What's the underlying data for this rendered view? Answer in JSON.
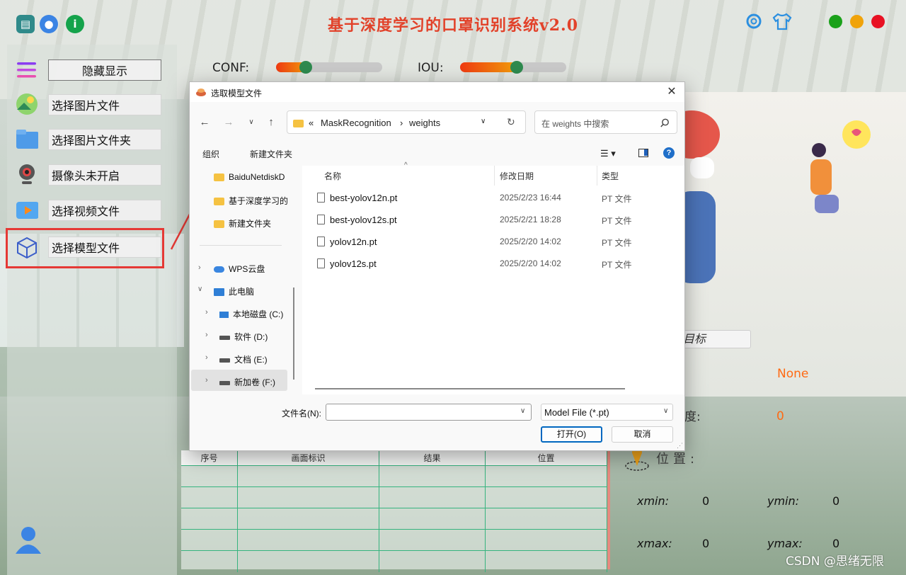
{
  "app": {
    "title": "基于深度学习的口罩识别系统v2.0",
    "colors": {
      "title": "#e2422a",
      "close": "#e81123",
      "minimize": "#f0a30a",
      "maximize": "#1aa11a",
      "slider_knob": "#2e8a4e",
      "value_accent": "#ff6a13",
      "highlight_box": "#e53935"
    },
    "top_icons": [
      "save-icon",
      "user-icon",
      "info-icon",
      "settings-gear-icon",
      "shirt-icon"
    ]
  },
  "sliders": {
    "conf_label": "CONF:",
    "conf_value": 0.3,
    "iou_label": "IOU:",
    "iou_value": 0.5
  },
  "sidebar": {
    "toggle_label": "隐藏显示",
    "items": [
      {
        "label": "选择图片文件",
        "icon": "image-file-icon"
      },
      {
        "label": "选择图片文件夹",
        "icon": "folder-icon"
      },
      {
        "label": "摄像头未开启",
        "icon": "webcam-icon"
      },
      {
        "label": "选择视频文件",
        "icon": "video-file-icon"
      },
      {
        "label": "选择模型文件",
        "icon": "model-cube-icon"
      }
    ]
  },
  "result_panel": {
    "target_select": "目标",
    "class_value": "None",
    "conf_label": "度:",
    "conf_value": "0",
    "position_label": "位置:",
    "xmin_label": "xmin:",
    "xmin": "0",
    "ymin_label": "ymin:",
    "ymin": "0",
    "xmax_label": "xmax:",
    "xmax": "0",
    "ymax_label": "ymax:",
    "ymax": "0"
  },
  "table": {
    "headers": [
      "序号",
      "画面标识",
      "结果",
      "位置"
    ]
  },
  "watermark": "CSDN @思绪无限",
  "dialog": {
    "title": "选取模型文件",
    "breadcrumb": [
      "«",
      "MaskRecognition",
      "›",
      "weights"
    ],
    "search_placeholder": "在 weights 中搜索",
    "toolbar": {
      "organize": "组织",
      "new_folder": "新建文件夹"
    },
    "tree": {
      "quick": [
        "BaiduNetdiskD",
        "基于深度学习的",
        "新建文件夹"
      ],
      "cloud": "WPS云盘",
      "this_pc": "此电脑",
      "drives": [
        "本地磁盘 (C:)",
        "软件 (D:)",
        "文档 (E:)",
        "新加卷 (F:)"
      ]
    },
    "columns": {
      "name": "名称",
      "date": "修改日期",
      "type": "类型"
    },
    "files": [
      {
        "name": "best-yolov12n.pt",
        "date": "2025/2/23 16:44",
        "type": "PT 文件"
      },
      {
        "name": "best-yolov12s.pt",
        "date": "2025/2/21 18:28",
        "type": "PT 文件"
      },
      {
        "name": "yolov12n.pt",
        "date": "2025/2/20 14:02",
        "type": "PT 文件"
      },
      {
        "name": "yolov12s.pt",
        "date": "2025/2/20 14:02",
        "type": "PT 文件"
      }
    ],
    "filename_label": "文件名(N):",
    "filename_value": "",
    "filetype": "Model File (*.pt)",
    "open_button": "打开(O)",
    "cancel_button": "取消"
  }
}
